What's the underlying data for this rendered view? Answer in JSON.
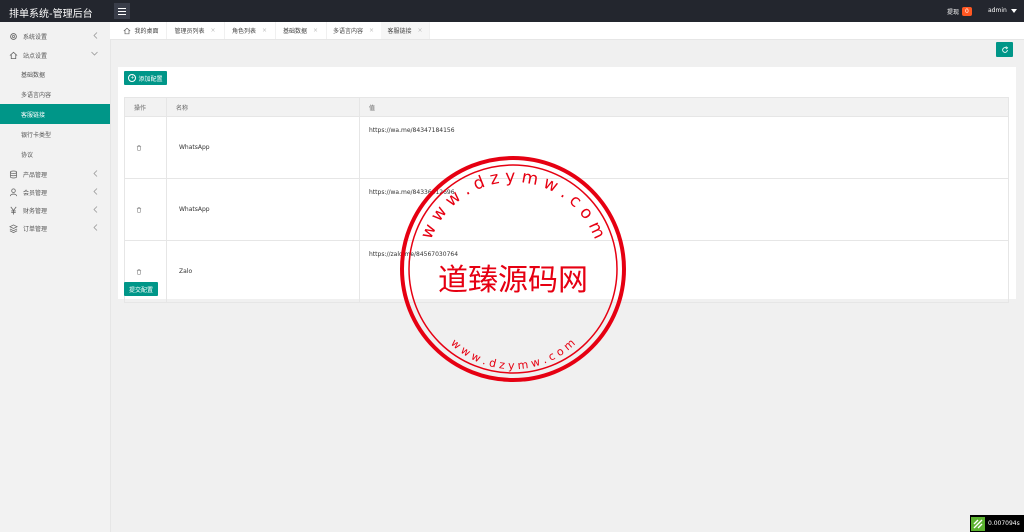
{
  "header": {
    "title": "排单系统-管理后台",
    "withdraw_label": "提现",
    "withdraw_count": "0",
    "username": "admin"
  },
  "sidebar": {
    "items": [
      {
        "label": "系统设置",
        "icon": "gear-icon"
      },
      {
        "label": "站点设置",
        "icon": "home-icon"
      },
      {
        "label": "产品管理",
        "icon": "database-icon"
      },
      {
        "label": "会员管理",
        "icon": "user-icon"
      },
      {
        "label": "财务管理",
        "icon": "yen-icon"
      },
      {
        "label": "订单管理",
        "icon": "stack-icon"
      }
    ],
    "sub_items": [
      "基础数据",
      "多语言内容",
      "客服链接",
      "银行卡类型",
      "协议"
    ]
  },
  "tabs": [
    {
      "label": "我的桌面"
    },
    {
      "label": "管理员列表"
    },
    {
      "label": "角色列表"
    },
    {
      "label": "基础数据"
    },
    {
      "label": "多语言内容"
    },
    {
      "label": "客服链接"
    }
  ],
  "tab_close": "×",
  "main": {
    "add_button": "添加配置",
    "submit_button": "提交配置",
    "columns": [
      "操作",
      "名称",
      "值"
    ],
    "rows": [
      {
        "name": "WhatsApp",
        "value": "https://wa.me/84347184156"
      },
      {
        "name": "WhatsApp",
        "value": "https://wa.me/84336412696"
      },
      {
        "name": "Zalo",
        "value": "https://zalo.me/84567030764"
      }
    ]
  },
  "stamp": {
    "center_text": "道臻源码网",
    "ring_text": "w w w . d z y m w . c o m"
  },
  "footer": {
    "timer": "0.007094s"
  },
  "colors": {
    "accent": "#009688",
    "topbar": "#23262e",
    "badge": "#ff5722",
    "stamp": "#e60012"
  }
}
